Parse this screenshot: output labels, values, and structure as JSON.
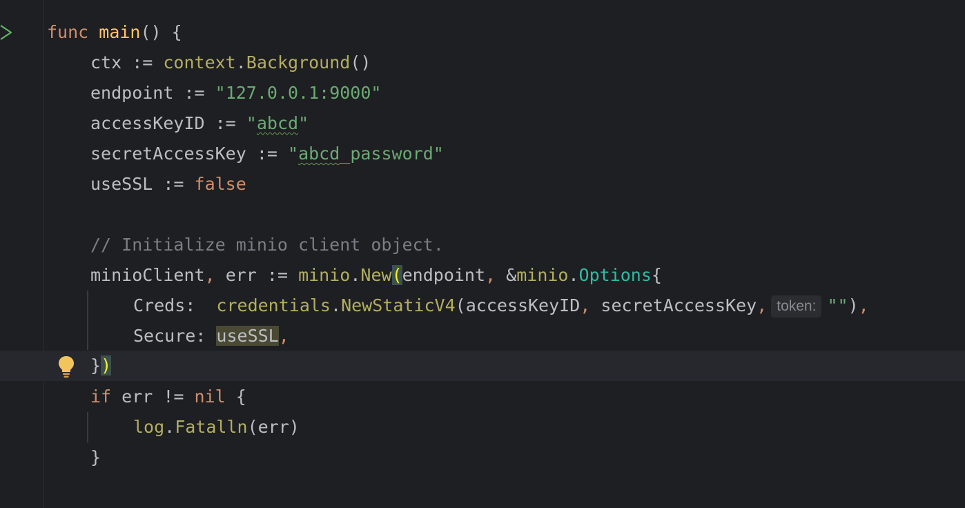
{
  "editor": {
    "lines": {
      "l1": {
        "kw": "func",
        "name": "main",
        "rest": "() {"
      },
      "l2": {
        "var": "ctx",
        "op": " := ",
        "pkg": "context",
        "dot": ".",
        "call": "Background",
        "rest": "()"
      },
      "l3": {
        "var": "endpoint",
        "op": " := ",
        "str": "\"127.0.0.1:9000\""
      },
      "l4": {
        "var": "accessKeyID",
        "op": " := ",
        "q1": "\"",
        "typo": "abcd",
        "q2": "\""
      },
      "l5": {
        "var": "secretAccessKey",
        "op": " := ",
        "q1": "\"",
        "typo": "abcd",
        "str_rest": "_password\""
      },
      "l6": {
        "var": "useSSL",
        "op": " := ",
        "kw": "false"
      },
      "l8": {
        "comment": "// Initialize minio client object."
      },
      "l9": {
        "var1": "minioClient",
        "comma": ",",
        "var2": " err",
        "op": " := ",
        "pkg": "minio",
        "dot": ".",
        "call": "New",
        "paren": "(",
        "arg1": "endpoint",
        "comma2": ",",
        "amp": " &",
        "pkg2": "minio",
        "dot2": ".",
        "type": "Options",
        "brace": "{"
      },
      "l10": {
        "field": "Creds:",
        "pad": "  ",
        "pkg": "credentials",
        "dot": ".",
        "call": "NewStaticV4",
        "paren": "(",
        "arg1": "accessKeyID",
        "comma1": ",",
        "arg2": " secretAccessKey",
        "comma2": ",",
        "hint": "token:",
        "str": "\"\"",
        "close": ")",
        "comma3": ","
      },
      "l11": {
        "field": "Secure:",
        "sp": " ",
        "var": "useSSL",
        "comma": ","
      },
      "l12": {
        "brace": "}",
        "paren": ")"
      },
      "l13": {
        "kw": "if",
        "mid": " err != ",
        "kw2": "nil",
        "rest": " {"
      },
      "l14": {
        "pkg": "log",
        "dot": ".",
        "call": "Fatalln",
        "rest": "(err)"
      },
      "l15": {
        "brace": "}"
      }
    }
  },
  "colors": {
    "background": "#1e1f22",
    "keyword": "#cf8e6d",
    "string": "#6aab73",
    "comment": "#7a7e85",
    "function_decl": "#ffc66d",
    "type": "#2fbaa3",
    "bracket_match": "#ffef28"
  },
  "icons": {
    "run": "run-gutter-icon",
    "intention": "lightbulb-icon"
  }
}
